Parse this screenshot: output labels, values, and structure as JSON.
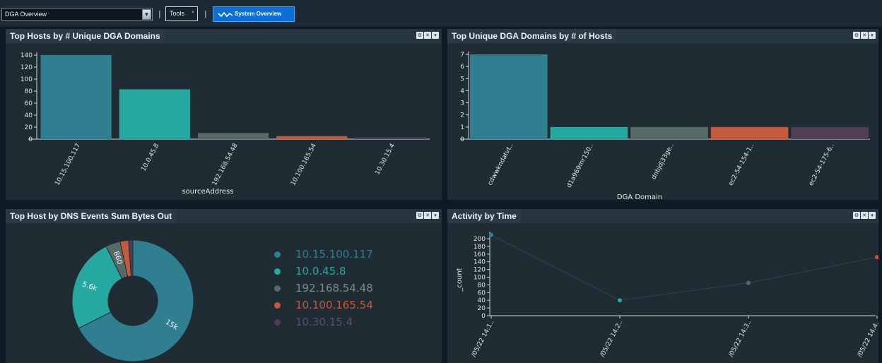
{
  "toolbar": {
    "dashboard_select": "DGA Overview",
    "tools_label": "Tools",
    "system_overview_label": "System Overview",
    "separator": "|"
  },
  "panels": {
    "hosts_by_dga": {
      "title": "Top Hosts by # Unique DGA Domains",
      "colors": [
        "#2f7f90",
        "#26a8a0",
        "#566a67",
        "#c25a3f",
        "#4f3e55"
      ]
    },
    "dga_by_hosts": {
      "title": "Top Unique DGA Domains by # of Hosts",
      "colors": [
        "#2f7f90",
        "#26a8a0",
        "#566a67",
        "#c25a3f",
        "#4f3e55"
      ]
    },
    "dns_bytes_out": {
      "title": "Top Host by DNS Events Sum Bytes Out",
      "legend": [
        {
          "label": "10.15.100.117",
          "color": "#2f7f90"
        },
        {
          "label": "10.0.45.8",
          "color": "#26a8a0"
        },
        {
          "label": "192.168.54.48",
          "color": "#566a67"
        },
        {
          "label": "10.100.165.54",
          "color": "#c25a3f"
        },
        {
          "label": "10.30.15.4",
          "color": "#4f3e55"
        }
      ]
    },
    "activity_by_time": {
      "title": "Activity by Time",
      "colors": [
        "#2f7f90",
        "#26a8a0",
        "#566a67",
        "#c25a3f"
      ]
    }
  },
  "chart_data": [
    {
      "type": "bar",
      "title": "Top Hosts by # Unique DGA Domains",
      "xlabel": "sourceAddress",
      "ylabel": "",
      "categories": [
        "10.15.100.117",
        "10.0.45.8",
        "192.168.54.48",
        "10.100.165.54",
        "10.30.15.4"
      ],
      "values": [
        140,
        83,
        10,
        5,
        3
      ],
      "ylim": [
        0,
        140
      ],
      "yticks": [
        0,
        20,
        40,
        60,
        80,
        100,
        120,
        140
      ]
    },
    {
      "type": "bar",
      "title": "Top Unique DGA Domains by # of Hosts",
      "xlabel": "DGA Domain",
      "ylabel": "",
      "categories": [
        "cdwwkndatvt..",
        "d1a969mr150..",
        "dnbjdj33ge..",
        "ec2-54-154-1..",
        "ec2-54-175-6.."
      ],
      "values": [
        7,
        1,
        1,
        1,
        1
      ],
      "ylim": [
        0,
        7
      ],
      "yticks": [
        0,
        1,
        2,
        3,
        4,
        5,
        6,
        7
      ]
    },
    {
      "type": "pie",
      "title": "Top Host by DNS Events Sum Bytes Out",
      "labels": [
        "10.15.100.117",
        "10.0.45.8",
        "192.168.54.48",
        "10.100.165.54",
        "10.30.15.4"
      ],
      "values": [
        15000,
        5600,
        860,
        500,
        250
      ],
      "slice_labels": [
        "15k",
        "5.6k",
        "860",
        "",
        ""
      ]
    },
    {
      "type": "scatter",
      "title": "Activity by Time",
      "ylabel": "_count",
      "x": [
        "05/22 14:1..",
        "05/22 14:2..",
        "05/22 14:3..",
        "05/22 14:4.."
      ],
      "x_tick_labels": [
        "/05/22 14:1..",
        "/05/22 14:2..",
        "/05/22 14:3..",
        "/05/22 14:4.."
      ],
      "values": [
        210,
        40,
        85,
        152
      ],
      "ylim": [
        0,
        200
      ],
      "yticks": [
        0,
        20,
        40,
        60,
        80,
        100,
        120,
        140,
        160,
        180,
        200
      ]
    }
  ]
}
